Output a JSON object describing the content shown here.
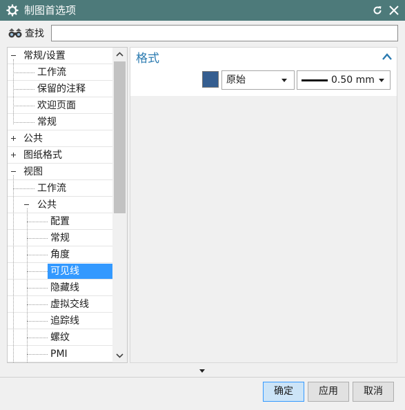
{
  "window": {
    "title": "制图首选项",
    "gear_icon": "gear-icon",
    "reset_icon": "reset-icon",
    "close_icon": "close-icon",
    "titlebar_color": "#4d7a7a"
  },
  "find": {
    "label": "查找",
    "value": ""
  },
  "tree": {
    "nodes": [
      {
        "label": "常规/设置",
        "level": 0,
        "toggle": "minus"
      },
      {
        "label": "工作流",
        "level": 1
      },
      {
        "label": "保留的注释",
        "level": 1
      },
      {
        "label": "欢迎页面",
        "level": 1
      },
      {
        "label": "常规",
        "level": 1
      },
      {
        "label": "公共",
        "level": 0,
        "toggle": "plus"
      },
      {
        "label": "图纸格式",
        "level": 0,
        "toggle": "plus"
      },
      {
        "label": "视图",
        "level": 0,
        "toggle": "minus"
      },
      {
        "label": "工作流",
        "level": 1
      },
      {
        "label": "公共",
        "level": 1,
        "toggle": "minus"
      },
      {
        "label": "配置",
        "level": 2
      },
      {
        "label": "常规",
        "level": 2
      },
      {
        "label": "角度",
        "level": 2
      },
      {
        "label": "可见线",
        "level": 2,
        "selected": true
      },
      {
        "label": "隐藏线",
        "level": 2
      },
      {
        "label": "虚拟交线",
        "level": 2
      },
      {
        "label": "追踪线",
        "level": 2
      },
      {
        "label": "螺纹",
        "level": 2
      },
      {
        "label": "PMI",
        "level": 2
      }
    ],
    "selection_color": "#3399ff"
  },
  "format_group": {
    "title": "格式",
    "color_swatch": "#355e90",
    "color_option": "原始",
    "width_option": "0.50 mm"
  },
  "buttons": {
    "ok": "确定",
    "apply": "应用",
    "cancel": "取消"
  }
}
